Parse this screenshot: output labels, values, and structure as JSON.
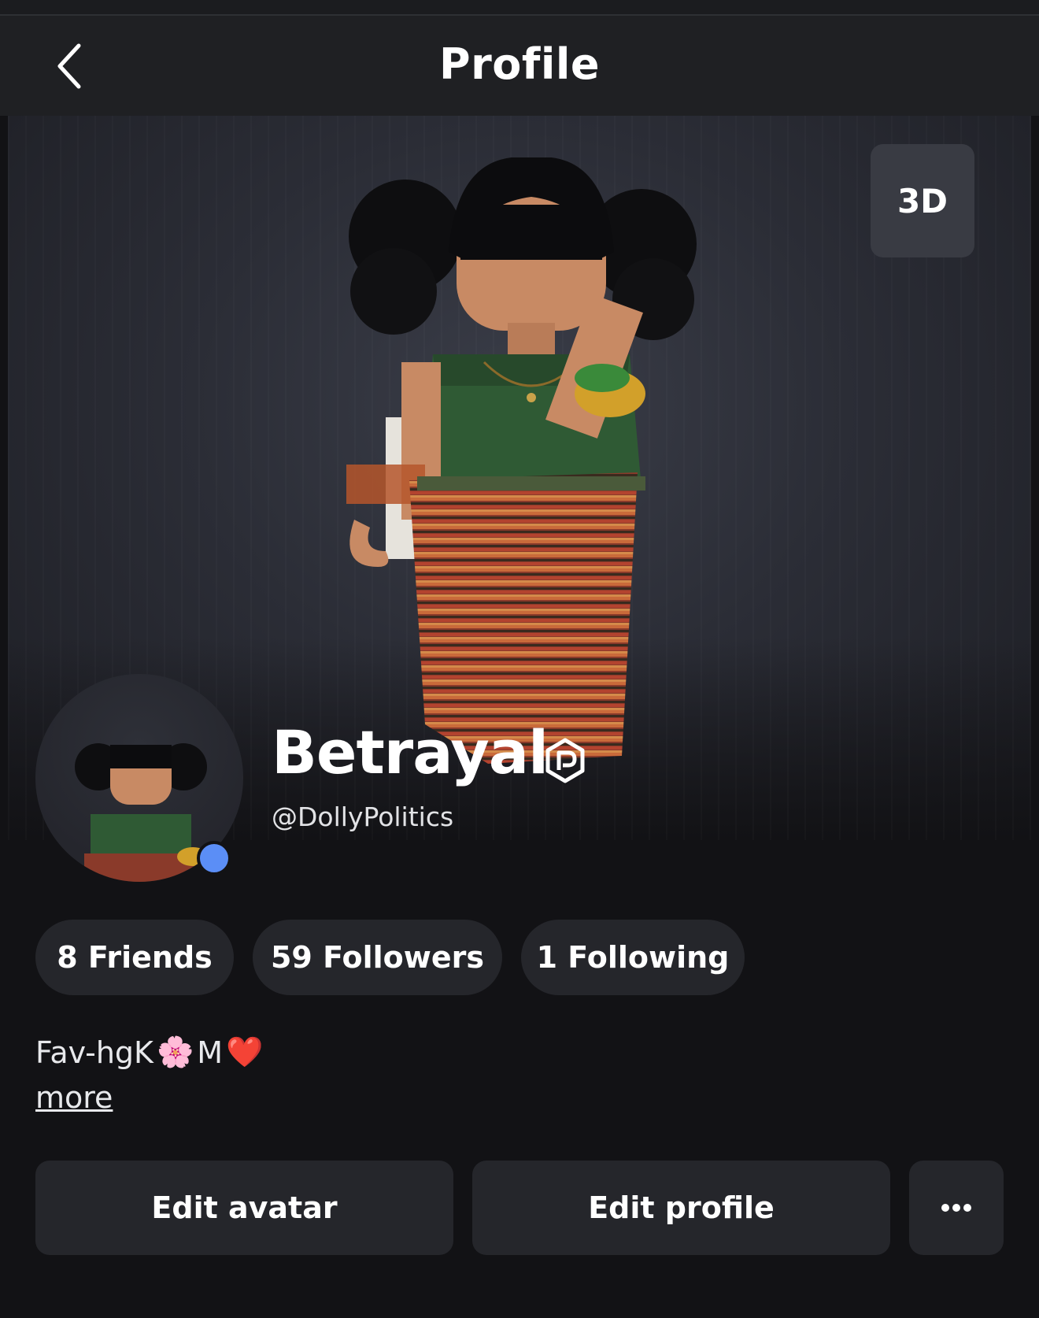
{
  "header": {
    "title": "Profile",
    "back_icon": "chevron-left-icon"
  },
  "hero": {
    "view_toggle_label": "3D"
  },
  "profile": {
    "display_name": "Betrayal",
    "badge_icon": "premium-badge-icon",
    "username": "@DollyPolitics",
    "online_status_color": "#5b8ef6"
  },
  "stats": {
    "friends": "8 Friends",
    "followers": "59 Followers",
    "following": "1 Following"
  },
  "bio": {
    "text_before": "Fav-hgK",
    "flower_emoji": "🌸",
    "text_middle": " M",
    "heart_emoji": "❤️",
    "more_label": "more"
  },
  "actions": {
    "edit_avatar": "Edit avatar",
    "edit_profile": "Edit profile",
    "more_icon": "more-horizontal-icon"
  },
  "colors": {
    "background": "#121215",
    "header": "#1f2023",
    "pill": "#25262b",
    "accent_online": "#5b8ef6"
  }
}
